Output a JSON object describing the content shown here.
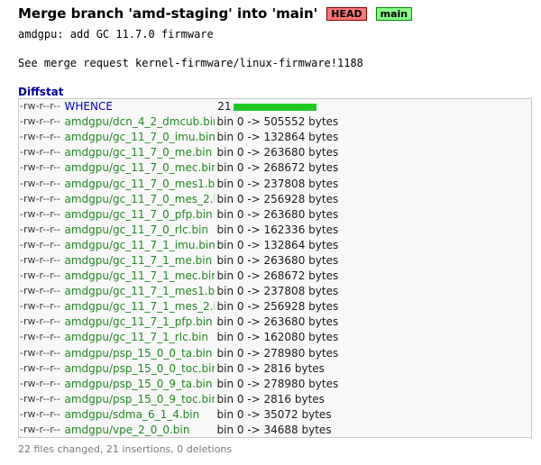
{
  "commit": {
    "subject": "Merge branch 'amd-staging' into 'main'",
    "decorations": {
      "head": "HEAD",
      "branch": "main"
    },
    "message_lines": [
      "amdgpu: add GC 11.7.0 firmware",
      "",
      "See merge request kernel-firmware/linux-firmware!1188"
    ]
  },
  "diffstat": {
    "header": "Diffstat",
    "rows": [
      {
        "mode": "-rw-r--r--",
        "file": "WHENCE",
        "type": "text",
        "count": "21",
        "graph_fraction": 1.0
      },
      {
        "mode": "-rw-r--r--",
        "file": "amdgpu/dcn_4_2_dmcub.bin",
        "type": "bin",
        "change": "bin 0 -> 505552 bytes"
      },
      {
        "mode": "-rw-r--r--",
        "file": "amdgpu/gc_11_7_0_imu.bin",
        "type": "bin",
        "change": "bin 0 -> 132864 bytes"
      },
      {
        "mode": "-rw-r--r--",
        "file": "amdgpu/gc_11_7_0_me.bin",
        "type": "bin",
        "change": "bin 0 -> 263680 bytes"
      },
      {
        "mode": "-rw-r--r--",
        "file": "amdgpu/gc_11_7_0_mec.bin",
        "type": "bin",
        "change": "bin 0 -> 268672 bytes"
      },
      {
        "mode": "-rw-r--r--",
        "file": "amdgpu/gc_11_7_0_mes1.bin",
        "type": "bin",
        "change": "bin 0 -> 237808 bytes"
      },
      {
        "mode": "-rw-r--r--",
        "file": "amdgpu/gc_11_7_0_mes_2.bin",
        "type": "bin",
        "change": "bin 0 -> 256928 bytes"
      },
      {
        "mode": "-rw-r--r--",
        "file": "amdgpu/gc_11_7_0_pfp.bin",
        "type": "bin",
        "change": "bin 0 -> 263680 bytes"
      },
      {
        "mode": "-rw-r--r--",
        "file": "amdgpu/gc_11_7_0_rlc.bin",
        "type": "bin",
        "change": "bin 0 -> 162336 bytes"
      },
      {
        "mode": "-rw-r--r--",
        "file": "amdgpu/gc_11_7_1_imu.bin",
        "type": "bin",
        "change": "bin 0 -> 132864 bytes"
      },
      {
        "mode": "-rw-r--r--",
        "file": "amdgpu/gc_11_7_1_me.bin",
        "type": "bin",
        "change": "bin 0 -> 263680 bytes"
      },
      {
        "mode": "-rw-r--r--",
        "file": "amdgpu/gc_11_7_1_mec.bin",
        "type": "bin",
        "change": "bin 0 -> 268672 bytes"
      },
      {
        "mode": "-rw-r--r--",
        "file": "amdgpu/gc_11_7_1_mes1.bin",
        "type": "bin",
        "change": "bin 0 -> 237808 bytes"
      },
      {
        "mode": "-rw-r--r--",
        "file": "amdgpu/gc_11_7_1_mes_2.bin",
        "type": "bin",
        "change": "bin 0 -> 256928 bytes"
      },
      {
        "mode": "-rw-r--r--",
        "file": "amdgpu/gc_11_7_1_pfp.bin",
        "type": "bin",
        "change": "bin 0 -> 263680 bytes"
      },
      {
        "mode": "-rw-r--r--",
        "file": "amdgpu/gc_11_7_1_rlc.bin",
        "type": "bin",
        "change": "bin 0 -> 162080 bytes"
      },
      {
        "mode": "-rw-r--r--",
        "file": "amdgpu/psp_15_0_0_ta.bin",
        "type": "bin",
        "change": "bin 0 -> 278980 bytes"
      },
      {
        "mode": "-rw-r--r--",
        "file": "amdgpu/psp_15_0_0_toc.bin",
        "type": "bin",
        "change": "bin 0 -> 2816 bytes"
      },
      {
        "mode": "-rw-r--r--",
        "file": "amdgpu/psp_15_0_9_ta.bin",
        "type": "bin",
        "change": "bin 0 -> 278980 bytes"
      },
      {
        "mode": "-rw-r--r--",
        "file": "amdgpu/psp_15_0_9_toc.bin",
        "type": "bin",
        "change": "bin 0 -> 2816 bytes"
      },
      {
        "mode": "-rw-r--r--",
        "file": "amdgpu/sdma_6_1_4.bin",
        "type": "bin",
        "change": "bin 0 -> 35072 bytes"
      },
      {
        "mode": "-rw-r--r--",
        "file": "amdgpu/vpe_2_0_0.bin",
        "type": "bin",
        "change": "bin 0 -> 34688 bytes"
      }
    ],
    "summary": "22 files changed, 21 insertions, 0 deletions"
  },
  "colors": {
    "head_decoration_bg": "#ff7777",
    "branch_decoration_bg": "#88ff88",
    "new_file_link": "#218a21",
    "modified_file_link": "#0000cc",
    "graph_bar": "#22c822"
  }
}
